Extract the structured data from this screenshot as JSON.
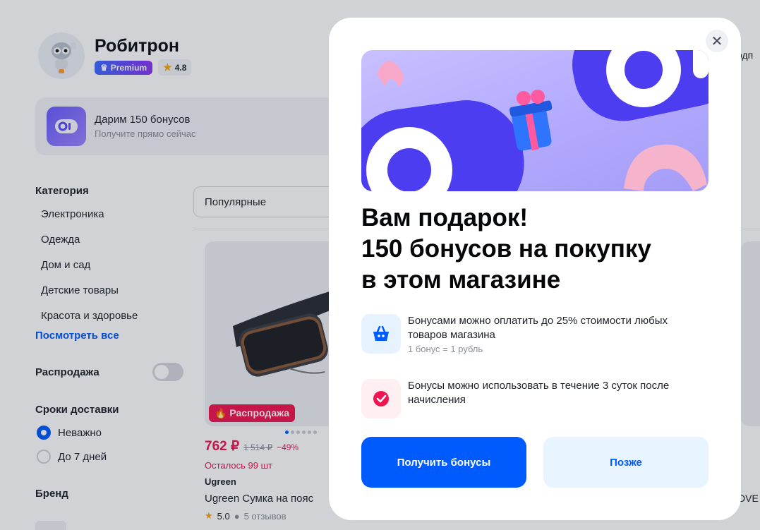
{
  "shop": {
    "name": "Робитрон",
    "premium_label": "Premium",
    "rating": "4.8",
    "header_right_text": "одп"
  },
  "bonus_banner": {
    "title": "Дарим 150 бонусов",
    "subtitle": "Получите прямо сейчас"
  },
  "filters": {
    "category_heading": "Категория",
    "categories": [
      "Электроника",
      "Одежда",
      "Дом и сад",
      "Детские товары",
      "Красота и здоровье"
    ],
    "see_all": "Посмотреть все",
    "sale_label": "Распродажа",
    "delivery_heading": "Сроки доставки",
    "delivery_options": [
      "Неважно",
      "До 7 дней"
    ],
    "brand_heading": "Бренд"
  },
  "sort": {
    "selected": "Популярные"
  },
  "product": {
    "badge": "Распродажа",
    "price": "762 ₽",
    "old_price": "1 514 ₽",
    "discount": "−49%",
    "stock": "Осталось 99 шт",
    "brand": "Ugreen",
    "name": "Ugreen Сумка на пояс",
    "rating": "5.0",
    "reviews": "5 отзывов"
  },
  "right_product": {
    "name_fragment": "DVE"
  },
  "modal": {
    "title_lines": [
      "Вам подарок!",
      "150 бонусов на покупку",
      "в этом магазине"
    ],
    "info1_text": "Бонусами можно оплатить до 25% стоимости любых товаров магазина",
    "info1_note": "1 бонус = 1 рубль",
    "info2_text": "Бонусы можно использовать в течение 3 суток после начисления",
    "primary_button": "Получить бонусы",
    "secondary_button": "Позже",
    "close_symbol": "✕"
  },
  "colors": {
    "accent": "#005bff",
    "sale": "#f0144f",
    "secondary_button_bg": "#e8f4ff"
  },
  "icons": [
    "shop-robot-logo-icon",
    "crown-icon",
    "star-icon",
    "bonus-logo-icon",
    "fire-icon",
    "comment-icon",
    "basket-icon",
    "clock-check-icon",
    "close-icon"
  ]
}
